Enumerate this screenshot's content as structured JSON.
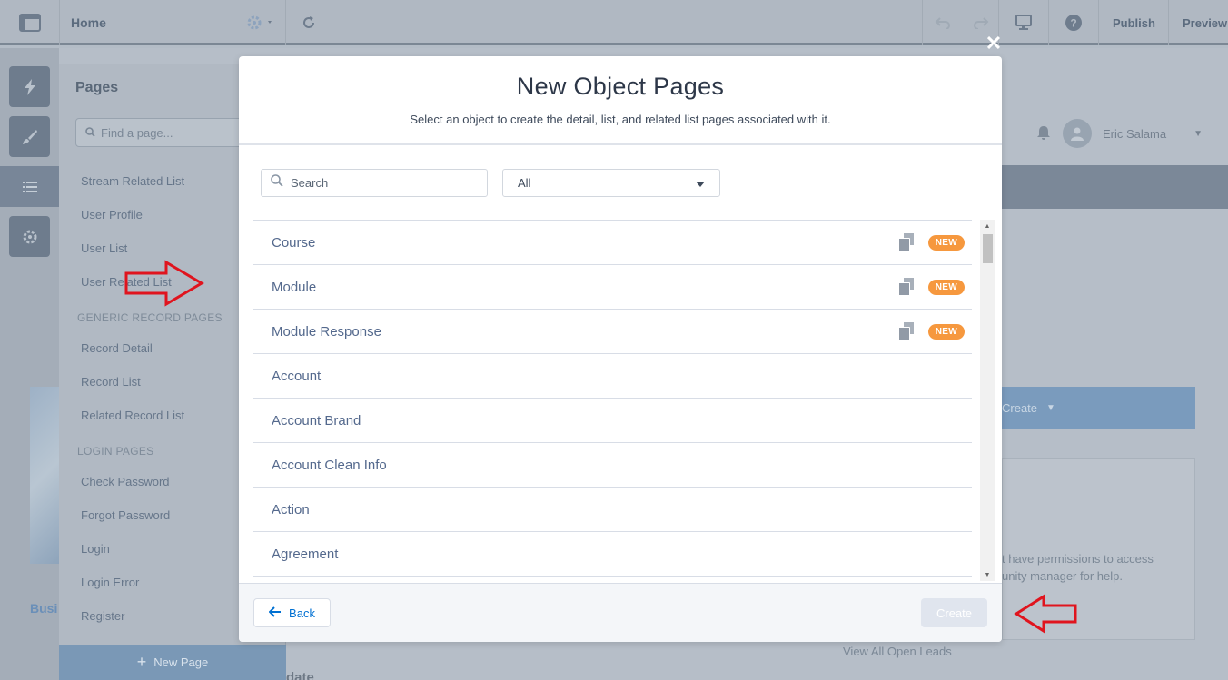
{
  "builder": {
    "page_selector": "Home",
    "top_actions": {
      "publish": "Publish",
      "preview": "Preview"
    },
    "pages_panel": {
      "title": "Pages",
      "search_placeholder": "Find a page...",
      "items": [
        "Stream Related List",
        "User Profile",
        "User List",
        "User Related List"
      ],
      "sections": [
        {
          "label": "GENERIC RECORD PAGES",
          "items": [
            "Record Detail",
            "Record List",
            "Related Record List"
          ]
        },
        {
          "label": "LOGIN PAGES",
          "items": [
            "Check Password",
            "Forgot Password",
            "Login",
            "Login Error",
            "Register"
          ]
        }
      ],
      "new_page_label": "New Page"
    },
    "preview": {
      "user_name": "Eric Salama",
      "create_label": "Create",
      "permission_text_1": "t have permissions to access",
      "permission_text_2": "unity manager for help.",
      "view_leads": "View All Open Leads",
      "tab_fragment": "Busi",
      "bottom_fragment": "date"
    }
  },
  "modal": {
    "title": "New Object Pages",
    "subtitle": "Select an object to create the detail, list, and related list pages associated with it.",
    "search_placeholder": "Search",
    "filter_selected": "All",
    "objects": [
      {
        "name": "Course",
        "is_new": true,
        "badge": "NEW"
      },
      {
        "name": "Module",
        "is_new": true,
        "badge": "NEW"
      },
      {
        "name": "Module Response",
        "is_new": true,
        "badge": "NEW"
      },
      {
        "name": "Account",
        "is_new": false
      },
      {
        "name": "Account Brand",
        "is_new": false
      },
      {
        "name": "Account Clean Info",
        "is_new": false
      },
      {
        "name": "Action",
        "is_new": false
      },
      {
        "name": "Agreement",
        "is_new": false
      },
      {
        "name": "",
        "is_new": false
      }
    ],
    "back_label": "Back",
    "create_label": "Create"
  },
  "annotations": {
    "arrow_color": "#e0141e"
  },
  "colors": {
    "accent": "#0070d2",
    "badge": "#f6983e",
    "object_text": "#54698d"
  }
}
